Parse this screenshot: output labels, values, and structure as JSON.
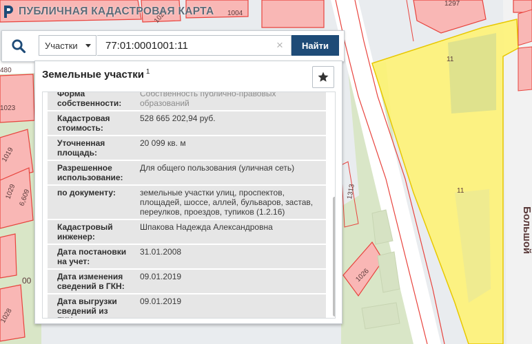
{
  "app": {
    "title": "ПУБЛИЧНАЯ КАДАСТРОВАЯ КАРТА"
  },
  "search": {
    "type_label": "Участки",
    "query": "77:01:0001001:11",
    "clear_icon": "×",
    "submit_label": "Найти"
  },
  "panel": {
    "title": "Земельные участки",
    "title_sup": "1",
    "rows": [
      {
        "key": "Форма собственности:",
        "value": "Собственность публично-правовых образований"
      },
      {
        "key": "Кадастровая стоимость:",
        "value": "528 665 202,94 руб."
      },
      {
        "key": "Уточненная площадь:",
        "value": "20 099 кв. м"
      },
      {
        "key": "Разрешенное использование:",
        "value": "Для общего пользования (уличная сеть)"
      },
      {
        "key": "по документу:",
        "value": "земельные участки улиц, проспектов, площадей, шоссе, аллей, бульваров, застав, переулков, проездов, тупиков (1.2.16)"
      },
      {
        "key": "Кадастровый инженер:",
        "value": "Шпакова Надежда Александровна"
      },
      {
        "key": "Дата постановки на учет:",
        "value": "31.01.2008"
      },
      {
        "key": "Дата изменения сведений в ГКН:",
        "value": "09.01.2019"
      },
      {
        "key": "Дата выгрузки сведений из ГКН:",
        "value": "09.01.2019"
      }
    ]
  },
  "map": {
    "labels": [
      "1297",
      "1004",
      "11",
      "11",
      "1019",
      "1029",
      "6,609",
      "1313",
      "1026",
      "Большой",
      "1028",
      "00",
      "480",
      "1021",
      "1023"
    ],
    "colors": {
      "parcel_fill": "#f9b7b5",
      "parcel_stroke": "#e8433d",
      "selected_fill": "#fff36e",
      "selected_stroke": "#e8c800",
      "green": "#d9e6c7",
      "road": "#ffffff"
    }
  },
  "icons": {
    "logo": "cadastral-logo-icon",
    "search": "search-icon",
    "caret": "caret-down-icon",
    "clear": "clear-icon",
    "star": "star-icon"
  }
}
